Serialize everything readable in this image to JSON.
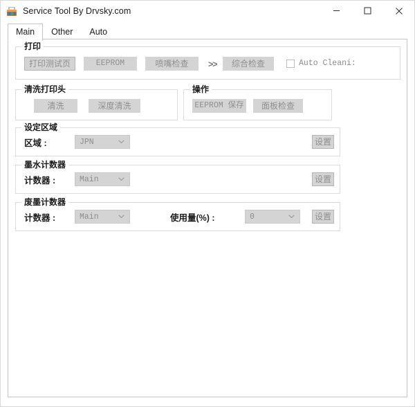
{
  "window": {
    "title": "Service Tool By Drvsky.com",
    "icon": "app-toolbox-icon",
    "controls": {
      "minimize": "minimize-icon",
      "maximize": "maximize-icon",
      "close": "close-icon"
    }
  },
  "tabs": [
    {
      "label": "Main",
      "selected": true
    },
    {
      "label": "Other",
      "selected": false
    },
    {
      "label": "Auto",
      "selected": false
    }
  ],
  "groups": {
    "print": {
      "legend": "打印",
      "buttons": [
        {
          "label": "打印测试页",
          "style": "outlined"
        },
        {
          "label": "EEPROM",
          "style": "flat-mono"
        },
        {
          "label": "喷嘴检查",
          "style": "flat"
        },
        {
          "label": "综合检查",
          "style": "flat"
        }
      ],
      "separator": ">>",
      "checkbox": {
        "label": "Auto Cleani:",
        "checked": false
      }
    },
    "clean_head": {
      "legend": "清洗打印头",
      "buttons": [
        {
          "label": "清洗",
          "style": "flat"
        },
        {
          "label": "深度清洗",
          "style": "flat"
        }
      ]
    },
    "operation": {
      "legend": "操作",
      "buttons": [
        {
          "label": "EEPROM 保存",
          "style": "flat-mono"
        },
        {
          "label": "面板检查",
          "style": "flat"
        }
      ]
    },
    "region": {
      "legend": "设定区域",
      "field_label": "区域 :",
      "combo_value": "JPN",
      "set_button": "设置"
    },
    "ink_counter": {
      "legend": "墨水计数器",
      "field_label": "计数器 :",
      "combo_value": "Main",
      "set_button": "设置"
    },
    "waste_ink_counter": {
      "legend": "废墨计数器",
      "field_label": "计数器 :",
      "combo_value": "Main",
      "usage_label": "使用量(%) :",
      "usage_value": "0",
      "set_button": "设置"
    }
  },
  "colors": {
    "window_bg": "#ffffff",
    "button_face": "#d4d4d4",
    "button_text": "#8f8f8f",
    "group_border": "#dcdcdc",
    "tab_border": "#c4c4c4",
    "text": "#1b1b1b"
  }
}
